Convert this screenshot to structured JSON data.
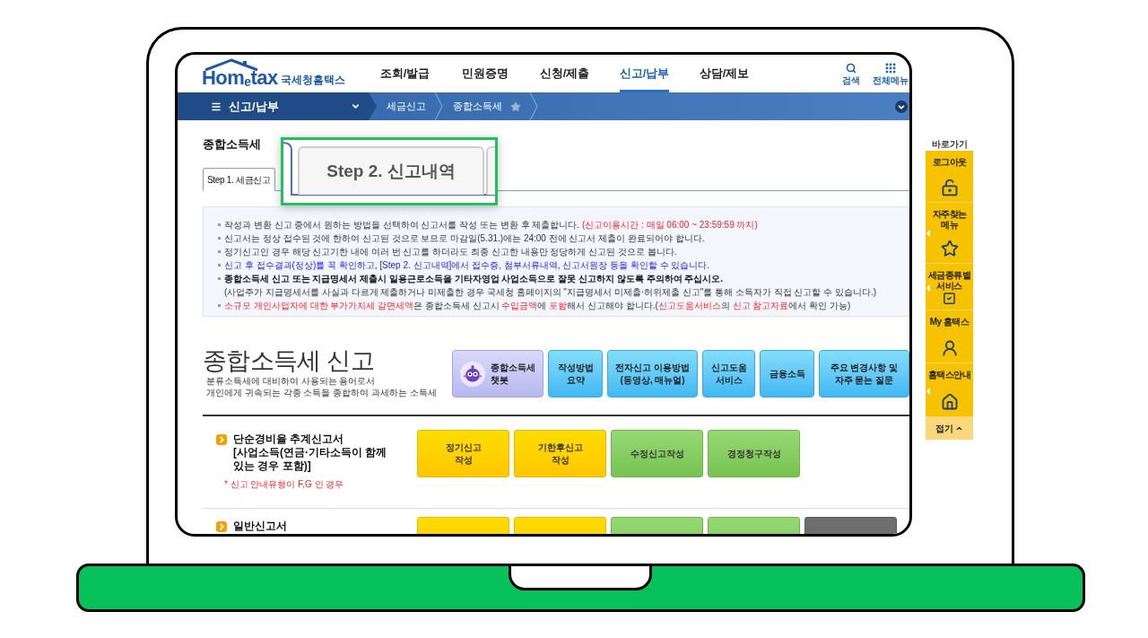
{
  "header": {
    "logo": {
      "wordmark": "Hom$_{e}$tax",
      "name": "국세청홈택스"
    },
    "nav": [
      {
        "label": "조회/발급",
        "selected": false
      },
      {
        "label": "민원증명",
        "selected": false
      },
      {
        "label": "신청/제출",
        "selected": false
      },
      {
        "label": "신고/납부",
        "selected": true
      },
      {
        "label": "상담/제보",
        "selected": false
      }
    ],
    "tools": [
      {
        "kind": "search",
        "label": "검색"
      },
      {
        "kind": "all_menu",
        "label": "전체메뉴"
      }
    ]
  },
  "menu_bar": {
    "section": "신고/납부",
    "breadcrumbs": [
      {
        "label": "세금신고"
      },
      {
        "label": "종합소득세",
        "favorite": false
      }
    ]
  },
  "page_title": "종합소득세",
  "tabs": [
    {
      "label": "Step 1. 세금신고",
      "selected": true
    }
  ],
  "callout": {
    "label": "Step 2. 신고내역"
  },
  "notices": [
    {
      "kind": "bullet",
      "segments": [
        {
          "text": "작성과 변환 신고 중에서 원하는 방법을 선택하여 신고서를 작성 또는 변환 후 제출합니다. ",
          "kind": "plain"
        },
        {
          "text": "(신고이용시간 : 매일 06:00 ~ 23:59:59 까지)",
          "kind": "warning"
        }
      ]
    },
    {
      "kind": "bullet",
      "segments": [
        {
          "text": "신고서는 정상 접수된 것에 한하여 신고된 것으로 보므로 마감일(5.31.)에는 24:00 전에 신고서 제출이 완료되어야 합니다.",
          "kind": "plain"
        }
      ]
    },
    {
      "kind": "bullet",
      "segments": [
        {
          "text": "정기신고인 경우 해당 신고기한 내에 여러 번 신고를 하더라도 최종 신고한 내용만 정당하게 신고된 것으로 봅니다.",
          "kind": "plain"
        }
      ]
    },
    {
      "kind": "bullet",
      "segments": [
        {
          "text": "신고 후 접수결과(정상)를 꼭 확인하고, [Step 2. 신고내역]에서 접수증, 첨부서류내역, 신고서원장 등을 확인할 수 있습니다.",
          "kind": "info"
        }
      ]
    },
    {
      "kind": "bullet",
      "segments": [
        {
          "text": "종합소득세 신고 또는 지급명세서 제출시 일용근로소득을 기타자영업 사업소득으로 잘못 신고하지 않도록 주의하여 주십시오.",
          "kind": "strong"
        }
      ]
    },
    {
      "kind": "continuation",
      "segments": [
        {
          "text": "(사업주가 지급명세서를 사실과 다르게 제출하거나 미제출한 경우 국세청 홈페이지의 \"지급명세서 미제출·허위제출 신고\"를 통해 소득자가 직접 신고할 수 있습니다.)",
          "kind": "plain"
        }
      ]
    },
    {
      "kind": "bullet",
      "segments": [
        {
          "text": "소규모 개인사업자에 대한 부가가치세 감면세액",
          "kind": "warning"
        },
        {
          "text": "은 종합소득세 신고시 ",
          "kind": "plain"
        },
        {
          "text": "수입금액",
          "kind": "warning"
        },
        {
          "text": "에 ",
          "kind": "plain"
        },
        {
          "text": "포함",
          "kind": "warning"
        },
        {
          "text": "해서 신고해야 합니다.(",
          "kind": "plain"
        },
        {
          "text": "신고도움서비스",
          "kind": "warning"
        },
        {
          "text": "의 ",
          "kind": "plain"
        },
        {
          "text": "신고 참고자료",
          "kind": "warning"
        },
        {
          "text": "에서 확인 가능)",
          "kind": "plain"
        }
      ]
    }
  ],
  "intro": {
    "title": "종합소득세 신고",
    "description": [
      "분류소득세에 대비하여 사용되는 용어로서",
      "개인에게 귀속되는 각종 소득을 종합하여 과세하는 소득세"
    ]
  },
  "quick_buttons": [
    {
      "kind": "chatbot",
      "label": "종합소득세\n챗봇"
    },
    {
      "kind": "info",
      "label": "작성방법\n요약"
    },
    {
      "kind": "info",
      "label": "전자신고 이용방법\n(동영상, 매뉴얼)"
    },
    {
      "kind": "info",
      "label": "신고도움\n서비스"
    },
    {
      "kind": "info",
      "label": "금융소득"
    },
    {
      "kind": "info",
      "label": "주요 변경사항 및\n자주 묻는 질문"
    }
  ],
  "forms": [
    {
      "title": "단순경비율 추계신고서\n[사업소득(연금·기타소득이 함께\n있는 경우 포함)]",
      "note": "* 신고 안내유형이 F,G 인 경우",
      "actions": [
        {
          "kind": "primary",
          "label": "정기신고\n작성"
        },
        {
          "kind": "primary",
          "label": "기한후신고\n작성"
        },
        {
          "kind": "secondary",
          "label": "수정신고작성"
        },
        {
          "kind": "secondary",
          "label": "경정청구작성"
        }
      ]
    },
    {
      "title": "일반신고서",
      "actions": [
        {
          "kind": "primary"
        },
        {
          "kind": "primary"
        },
        {
          "kind": "secondary"
        },
        {
          "kind": "secondary"
        },
        {
          "kind": "tertiary"
        }
      ]
    }
  ],
  "sidebar": {
    "title": "바로가기",
    "items": [
      {
        "kind": "logout",
        "label": "로그아웃",
        "submenu": false
      },
      {
        "kind": "favorites",
        "label": "자주찾는\n메뉴",
        "submenu": true
      },
      {
        "kind": "tax_types",
        "label": "세금종류별\n서비스",
        "submenu": true
      },
      {
        "kind": "my_page",
        "label": "My 홈택스",
        "submenu": false
      },
      {
        "kind": "guide",
        "label": "홈택스안내",
        "submenu": true
      }
    ],
    "collapse": "접기"
  }
}
